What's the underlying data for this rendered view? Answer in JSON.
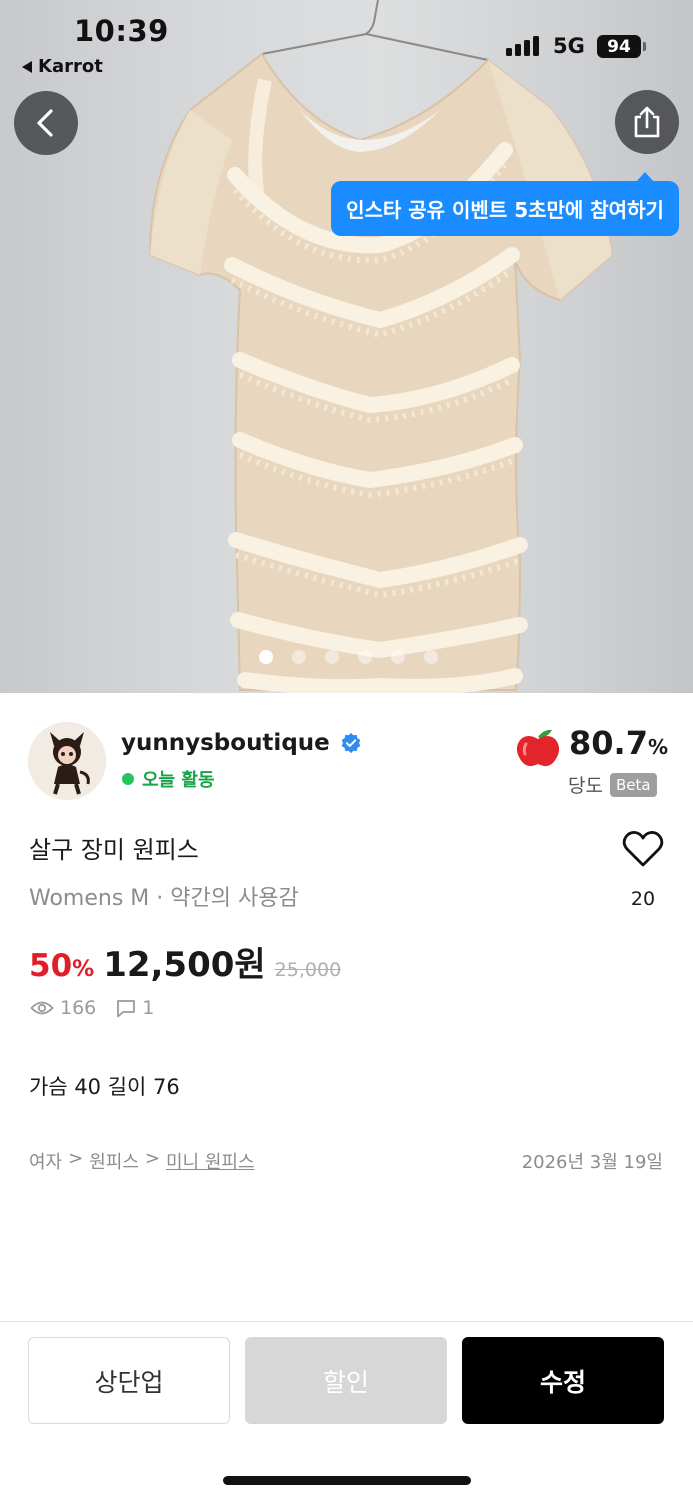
{
  "status_bar": {
    "time": "10:39",
    "back_app": "Karrot",
    "network": "5G",
    "battery": "94"
  },
  "hero": {
    "tooltip": "인스타 공유 이벤트 5초만에 참여하기",
    "dot_count": 6,
    "active_dot": 1
  },
  "seller": {
    "name": "yunnysboutique",
    "activity": "오늘 활동",
    "temperature": "80.7",
    "temperature_unit": "%",
    "temperature_label": "당도",
    "beta": "Beta"
  },
  "product": {
    "title": "살구 장미 원피스",
    "meta": "Womens M · 약간의 사용감",
    "likes": "20",
    "discount": "50",
    "discount_unit": "%",
    "price": "12,500원",
    "original_price": "25,000",
    "views": "166",
    "chats": "1",
    "description": "가슴 40 길이 76",
    "breadcrumb": {
      "level1": "여자",
      "sep1": ">",
      "level2": "원피스",
      "sep2": ">",
      "level3": "미니 원피스"
    },
    "date": "2026년 3월 19일"
  },
  "actions": {
    "bump": "상단업",
    "discount": "할인",
    "edit": "수정"
  },
  "colors": {
    "accent_blue": "#1a8cff",
    "discount_red": "#e11d2a",
    "active_green": "#16a34a"
  },
  "icons": [
    "back-arrow-icon",
    "share-icon",
    "verified-badge-icon",
    "apple-icon",
    "heart-icon",
    "eye-icon",
    "chat-icon"
  ]
}
